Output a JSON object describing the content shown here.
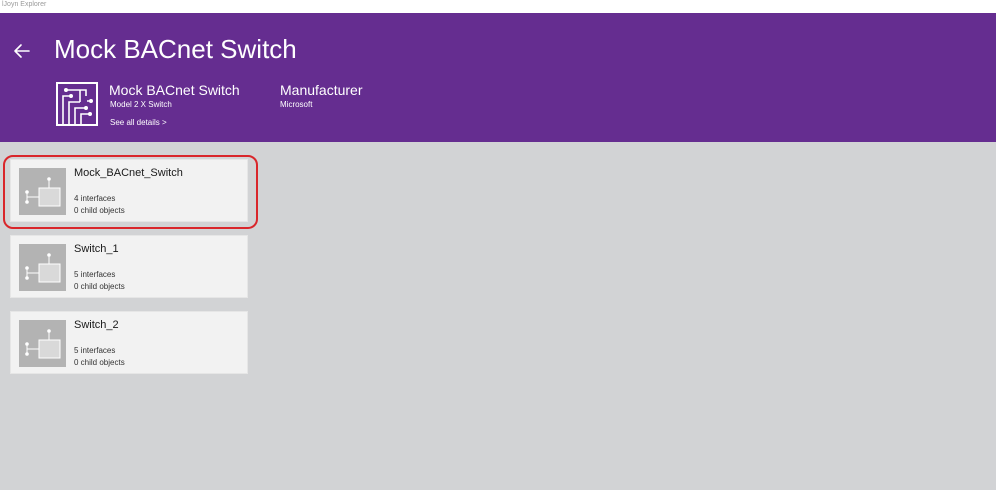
{
  "window": {
    "title": "lJoyn Explorer"
  },
  "header": {
    "title": "Mock BACnet Switch",
    "accent_color": "#652d90",
    "back_icon": "back-arrow-icon",
    "device": {
      "icon": "circuit-board-icon",
      "name": "Mock BACnet Switch",
      "model": "Model 2 X Switch",
      "details_link": "See all details >"
    },
    "manufacturer": {
      "label": "Manufacturer",
      "value": "Microsoft"
    }
  },
  "objects": [
    {
      "name": "Mock_BACnet_Switch",
      "interfaces": "4 interfaces",
      "children": "0 child objects",
      "highlighted": true
    },
    {
      "name": "Switch_1",
      "interfaces": "5 interfaces",
      "children": "0 child objects",
      "highlighted": false
    },
    {
      "name": "Switch_2",
      "interfaces": "5 interfaces",
      "children": "0 child objects",
      "highlighted": false
    }
  ],
  "highlight_color": "#d9262b"
}
